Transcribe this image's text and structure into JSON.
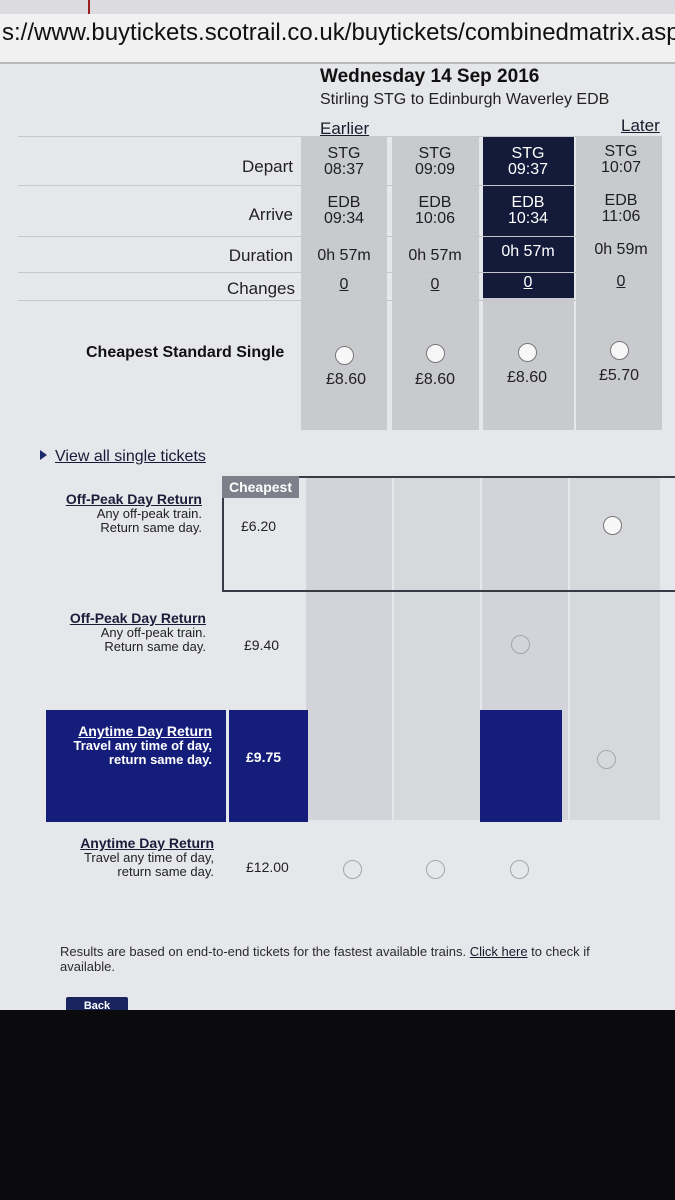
{
  "browser": {
    "url": "s://www.buytickets.scotrail.co.uk/buytickets/combinedmatrix.aspx?Co"
  },
  "journey": {
    "date": "Wednesday 14 Sep 2016",
    "route": "Stirling STG to Edinburgh Waverley EDB",
    "earlier_label": "Earlier",
    "later_label": "Later"
  },
  "row_labels": {
    "depart": "Depart",
    "arrive": "Arrive",
    "duration": "Duration",
    "changes": "Changes",
    "cheapest": "Cheapest Standard Single"
  },
  "trains": [
    {
      "dep_station": "STG",
      "dep_time": "08:37",
      "arr_station": "EDB",
      "arr_time": "09:34",
      "duration": "0h 57m",
      "changes": "0",
      "price": "£8.60",
      "selected": false
    },
    {
      "dep_station": "STG",
      "dep_time": "09:09",
      "arr_station": "EDB",
      "arr_time": "10:06",
      "duration": "0h 57m",
      "changes": "0",
      "price": "£8.60",
      "selected": false
    },
    {
      "dep_station": "STG",
      "dep_time": "09:37",
      "arr_station": "EDB",
      "arr_time": "10:34",
      "duration": "0h 57m",
      "changes": "0",
      "price": "£8.60",
      "selected": true
    },
    {
      "dep_station": "STG",
      "dep_time": "10:07",
      "arr_station": "EDB",
      "arr_time": "11:06",
      "duration": "0h 59m",
      "changes": "0",
      "price": "£5.70",
      "selected": false
    }
  ],
  "view_all_label": "View all single tickets",
  "cheapest_tag": "Cheapest",
  "tickets": [
    {
      "name": "Off-Peak Day Return",
      "desc1": "Any off-peak train.",
      "desc2": "Return same day.",
      "price": "£6.20"
    },
    {
      "name": "Off-Peak Day Return",
      "desc1": "Any off-peak train.",
      "desc2": "Return same day.",
      "price": "£9.40"
    },
    {
      "name": "Anytime Day Return",
      "desc1": "Travel any time of day,",
      "desc2": "return same day.",
      "price": "£9.75"
    },
    {
      "name": "Anytime Day Return",
      "desc1": "Travel any time of day,",
      "desc2": "return same day.",
      "price": "£12.00"
    }
  ],
  "footnote": {
    "text": "Results are based on end-to-end tickets for the fastest available trains.",
    "link": "Click here",
    "after": "to check if",
    "line2": "available."
  },
  "back_label": "Back",
  "colors": {
    "selected_navy": "#141d7a",
    "dark_column": "#141b3a",
    "page_bg": "#e6e7ea"
  }
}
